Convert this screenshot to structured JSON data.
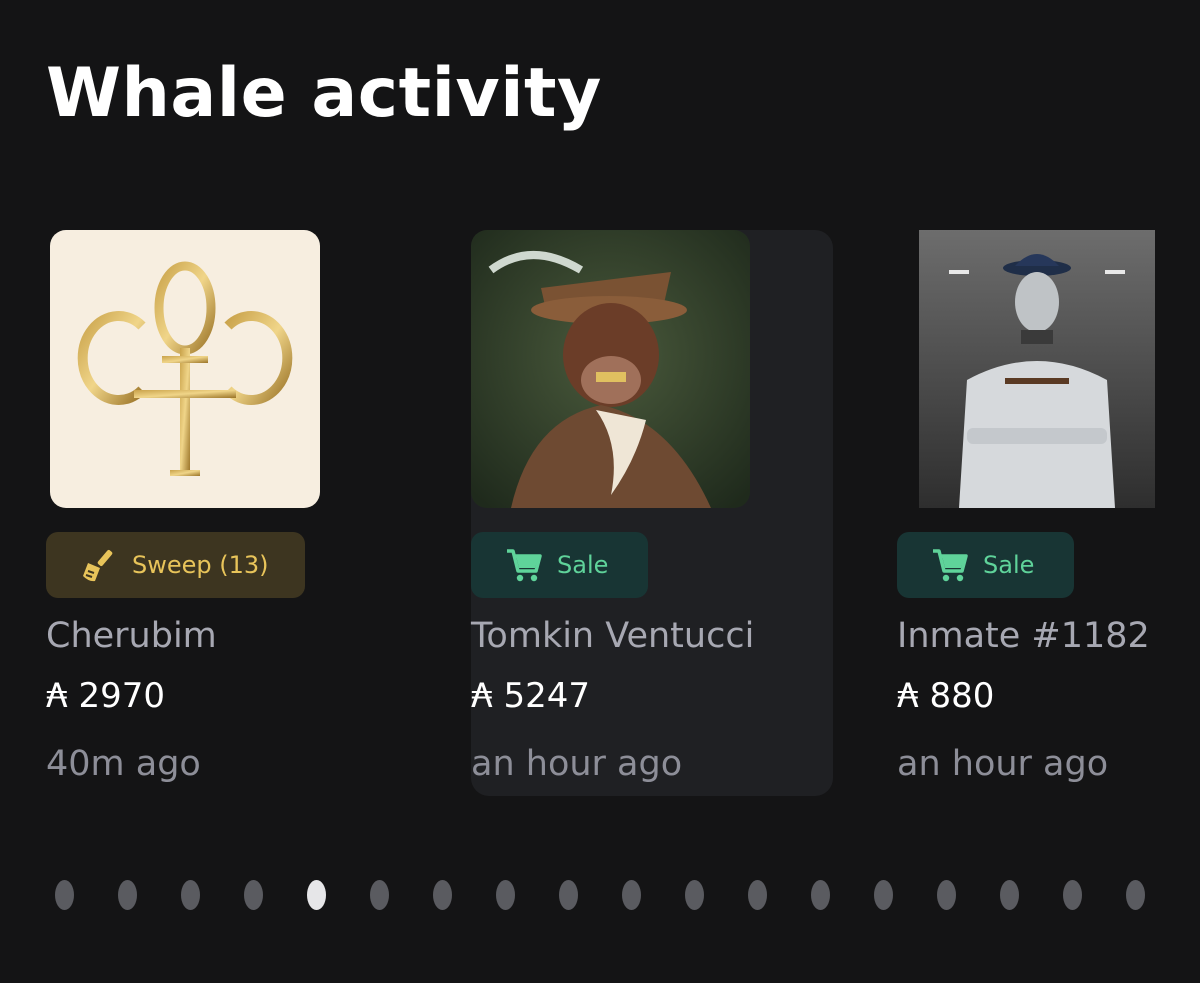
{
  "header": {
    "title": "Whale activity"
  },
  "cards": [
    {
      "badge": {
        "type": "sweep",
        "label": "Sweep (13)",
        "icon": "broom-icon",
        "color": "#e8c45a"
      },
      "name": "Cherubim",
      "price": "₳ 2970",
      "time": "40m ago",
      "highlighted": false
    },
    {
      "badge": {
        "type": "sale",
        "label": "Sale",
        "icon": "cart-icon",
        "color": "#5fd39a"
      },
      "name": "Tomkin Ventucci",
      "price": "₳ 5247",
      "time": "an hour ago",
      "highlighted": true
    },
    {
      "badge": {
        "type": "sale",
        "label": "Sale",
        "icon": "cart-icon",
        "color": "#5fd39a"
      },
      "name": "Inmate #1182",
      "price": "₳ 880",
      "time": "an hour ago",
      "highlighted": false
    }
  ],
  "pagination": {
    "total": 18,
    "active_index": 4
  }
}
